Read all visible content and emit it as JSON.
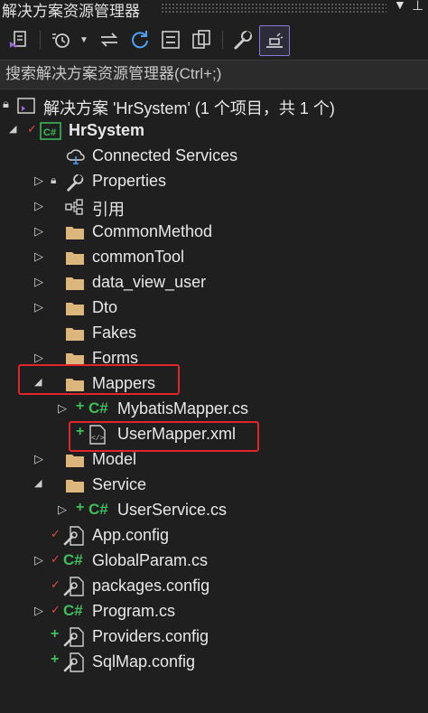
{
  "window": {
    "title": "解决方案资源管理器"
  },
  "search": {
    "placeholder": "搜索解决方案资源管理器(Ctrl+;)"
  },
  "tree": {
    "solution": {
      "label": "解决方案 'HrSystem' (1 个项目，共 1 个)"
    },
    "project": {
      "label": "HrSystem"
    },
    "items": [
      {
        "label": "Connected Services",
        "icon": "connected-services-icon"
      },
      {
        "label": "Properties",
        "icon": "wrench-icon"
      },
      {
        "label": "引用",
        "icon": "references-icon"
      },
      {
        "label": "CommonMethod",
        "icon": "folder-icon"
      },
      {
        "label": "commonTool",
        "icon": "folder-icon"
      },
      {
        "label": "data_view_user",
        "icon": "folder-icon"
      },
      {
        "label": "Dto",
        "icon": "folder-icon"
      },
      {
        "label": "Fakes",
        "icon": "folder-icon"
      },
      {
        "label": "Forms",
        "icon": "folder-icon"
      },
      {
        "label": "Mappers",
        "icon": "folder-icon"
      },
      {
        "label": "MybatisMapper.cs",
        "icon": "csharp-file-icon"
      },
      {
        "label": "UserMapper.xml",
        "icon": "xml-file-icon"
      },
      {
        "label": "Model",
        "icon": "folder-icon"
      },
      {
        "label": "Service",
        "icon": "folder-icon"
      },
      {
        "label": "UserService.cs",
        "icon": "csharp-file-icon"
      },
      {
        "label": "App.config",
        "icon": "config-file-icon"
      },
      {
        "label": "GlobalParam.cs",
        "icon": "csharp-file-icon"
      },
      {
        "label": "packages.config",
        "icon": "config-file-icon"
      },
      {
        "label": "Program.cs",
        "icon": "csharp-file-icon"
      },
      {
        "label": "Providers.config",
        "icon": "config-file-icon"
      },
      {
        "label": "SqlMap.config",
        "icon": "config-file-icon"
      }
    ]
  },
  "colors": {
    "background": "#1f1f1f",
    "folder": "#dcb67a",
    "csharp_green": "#3fbf5a",
    "highlight": "#e0262b",
    "accent": "#8a7cd6"
  }
}
